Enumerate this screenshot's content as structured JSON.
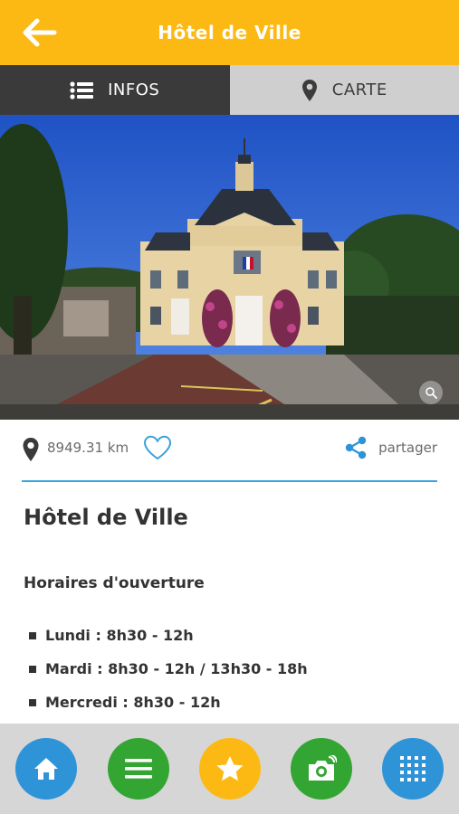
{
  "header": {
    "title": "Hôtel de Ville",
    "back_icon": "arrow-left-icon"
  },
  "tabs": [
    {
      "label": "INFOS",
      "icon": "list-icon",
      "active": true
    },
    {
      "label": "CARTE",
      "icon": "map-pin-icon",
      "active": false
    }
  ],
  "photo": {
    "zoom_icon": "magnifier-icon"
  },
  "meta": {
    "distance": "8949.31 km",
    "favorite_icon": "heart-icon",
    "share_label": "partager",
    "share_icon": "share-icon"
  },
  "content": {
    "title": "Hôtel de Ville",
    "hours_title": "Horaires d'ouverture",
    "hours": [
      "Lundi : 8h30 - 12h",
      "Mardi : 8h30 - 12h / 13h30 - 18h",
      "Mercredi : 8h30 - 12h"
    ]
  },
  "bottom_nav": [
    {
      "name": "home",
      "icon": "home-icon",
      "color": "#2f93d8"
    },
    {
      "name": "menu",
      "icon": "menu-icon",
      "color": "#33a532"
    },
    {
      "name": "favorites",
      "icon": "star-icon",
      "color": "#fdb913"
    },
    {
      "name": "camera",
      "icon": "camera-icon",
      "color": "#33a532"
    },
    {
      "name": "grid",
      "icon": "grid-icon",
      "color": "#2f93d8"
    }
  ],
  "colors": {
    "header": "#fdb913",
    "accent": "#3aa3dc",
    "tab_active": "#3a3a3a",
    "tab_inactive": "#cfcfcf"
  }
}
